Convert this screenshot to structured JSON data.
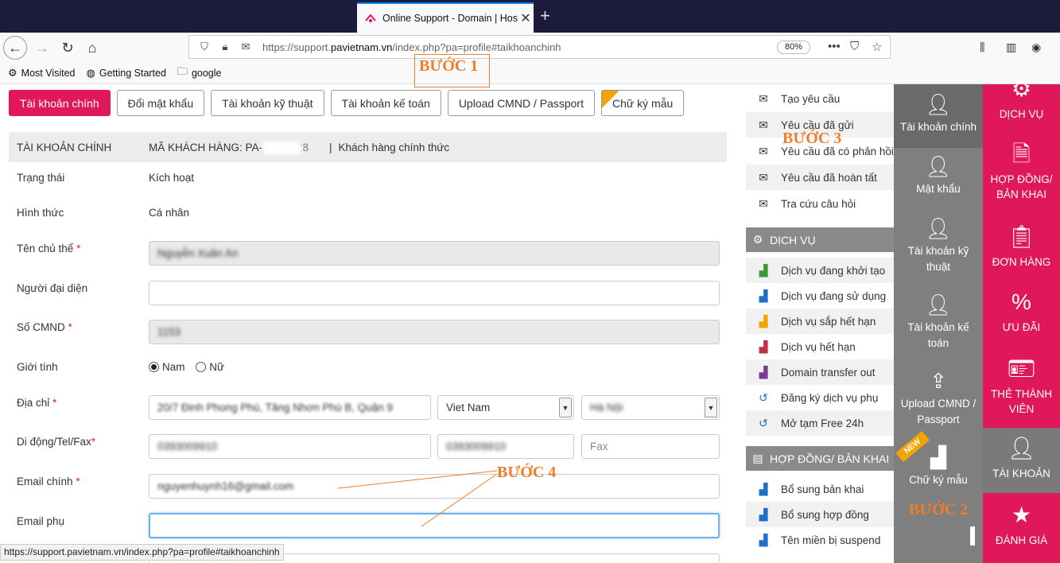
{
  "browser": {
    "tab_title": "Online Support - Domain | Hos",
    "url_domain": "https://support.",
    "url_host": "pavietnam.vn",
    "url_path": "/index.php?pa=profile#taikhoanchinh",
    "zoom": "80%",
    "bookmarks": [
      "Most Visited",
      "Getting Started",
      "google"
    ],
    "status_url": "https://support.pavietnam.vn/index.php?pa=profile#taikhoanchinh"
  },
  "tabs": [
    "Tài khoản chính",
    "Đổi mật khẩu",
    "Tài khoản kỹ thuật",
    "Tài khoản kế toán",
    "Upload CMND / Passport",
    "Chữ ký mẫu"
  ],
  "header": {
    "title": "TÀI KHOẢN CHÍNH",
    "customer_code_label": "MÃ KHÁCH HÀNG: PA-",
    "customer_code_partial": "2128",
    "separator": "|",
    "customer_type": "Khách hàng chính thức"
  },
  "form": {
    "status_label": "Trạng thái",
    "status_value": "Kích hoạt",
    "type_label": "Hình thức",
    "type_value": "Cá nhân",
    "owner_label": "Tên chủ thể",
    "owner_value": "Nguyễn Xuân An",
    "rep_label": "Người đại diện",
    "id_label": "Số CMND",
    "id_value": "1153",
    "gender_label": "Giới tính",
    "gender_male": "Nam",
    "gender_female": "Nữ",
    "address_label": "Địa chỉ",
    "address_value": "20/7 Đinh Phong Phú, Tăng Nhơn Phú B, Quận 9",
    "country_value": "Viet Nam",
    "city_value": "Hà Nội",
    "phone_label": "Di động/Tel/Fax",
    "mobile_value": "0393009910",
    "tel_value": "0393009910",
    "fax_placeholder": "Fax",
    "email_label": "Email chính",
    "email_value": "nguyenhuynh16@gmail.com",
    "email2_label": "Email phụ",
    "required_mark": "*"
  },
  "steps": [
    "BƯỚC 1",
    "BƯỚC 2",
    "BƯỚC 3",
    "BƯỚC 4"
  ],
  "dropdown": {
    "support_items": [
      "Tạo yêu cầu",
      "Yêu cầu đã gửi",
      "Yêu cầu đã có phản hồi",
      "Yêu cầu đã hoàn tất",
      "Tra cứu câu hỏi"
    ],
    "service_header": "DỊCH VỤ",
    "service_items": [
      "Dịch vụ đang khởi tạo",
      "Dịch vụ đang sử dụng",
      "Dịch vụ sắp hết hạn",
      "Dịch vụ hết hạn",
      "Domain transfer out",
      "Đăng ký dịch vụ phụ",
      "Mở tạm Free 24h"
    ],
    "contract_header": "HỢP ĐỒNG/ BẢN KHAI",
    "contract_items": [
      "Bổ sung bản khai",
      "Bổ sung hợp đồng",
      "Tên miền bị suspend"
    ]
  },
  "subsidebar": [
    "Tài khoản chính",
    "Mật khẩu",
    "Tài khoản kỹ thuật",
    "Tài khoản kế toán",
    "Upload CMND / Passport",
    "Chữ ký mẫu"
  ],
  "new_badge": "NEW",
  "mainsidebar": [
    "DỊCH VỤ",
    "HỢP ĐỒNG/ BẢN KHAI",
    "ĐƠN HÀNG",
    "ƯU ĐÃI",
    "THẺ THÀNH VIÊN",
    "TÀI KHOẢN",
    "ĐÁNH GIÁ"
  ],
  "colors": {
    "brand": "#e0185a",
    "step": "#f07d28",
    "gray_sidebar": "#7f7f7f"
  }
}
